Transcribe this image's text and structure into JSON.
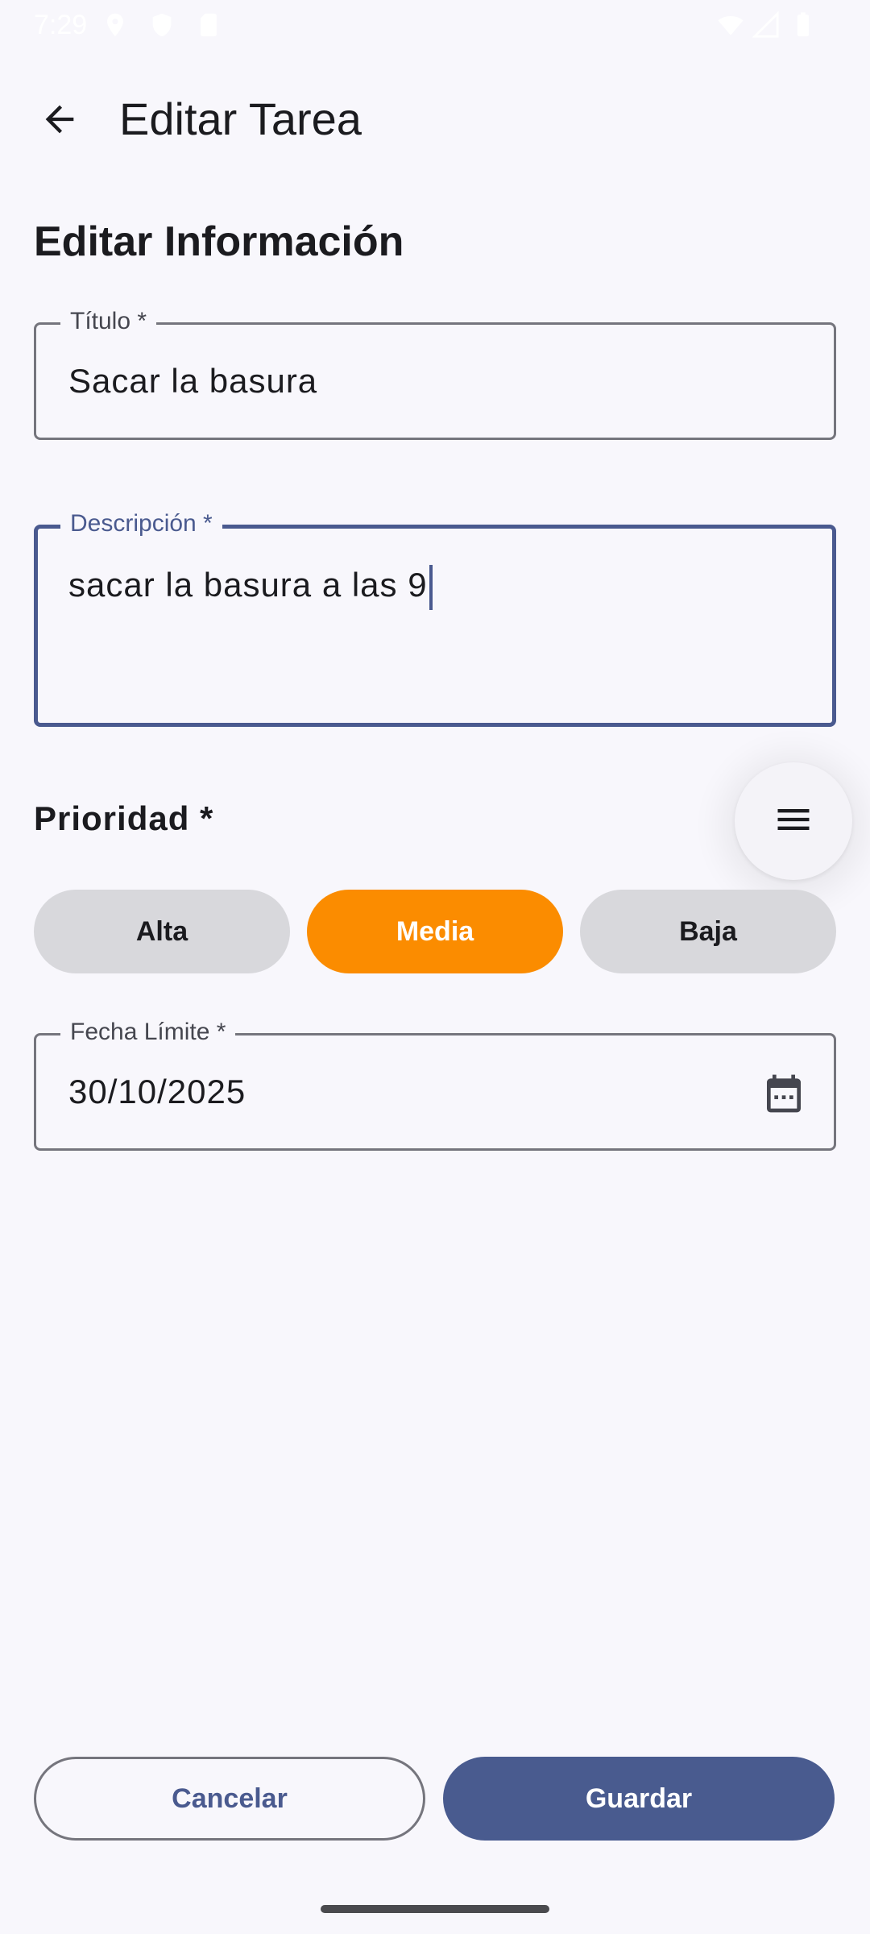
{
  "status_bar": {
    "time": "7:29",
    "icons": [
      "location-icon",
      "shield-icon",
      "sim-card-icon",
      "wifi-icon",
      "signal-icon",
      "battery-icon"
    ]
  },
  "app_bar": {
    "back_icon": "arrow-back-icon",
    "title": "Editar Tarea"
  },
  "form": {
    "section_title": "Editar Información",
    "title_field": {
      "label": "Título *",
      "value": "Sacar la basura"
    },
    "description_field": {
      "label": "Descripción *",
      "value": "sacar la basura a las 9"
    },
    "priority": {
      "label": "Prioridad *",
      "options": [
        "Alta",
        "Media",
        "Baja"
      ],
      "selected": "Media"
    },
    "due_date_field": {
      "label": "Fecha Límite *",
      "value": "30/10/2025",
      "icon": "calendar-icon"
    }
  },
  "fab": {
    "icon": "menu-icon"
  },
  "actions": {
    "cancel_label": "Cancelar",
    "save_label": "Guardar"
  },
  "colors": {
    "primary": "#495b8f",
    "priority_selected": "#fb8c00",
    "priority_unselected": "#d8d8dc",
    "background": "#f8f7fc"
  }
}
